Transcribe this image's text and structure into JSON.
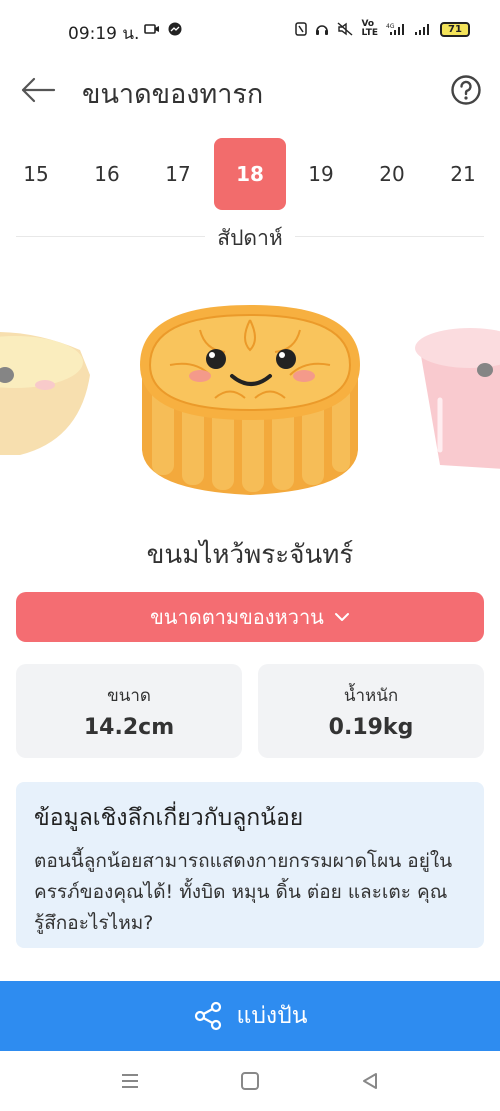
{
  "status": {
    "time": "09:19 น.",
    "battery": "71",
    "network": "4G"
  },
  "header": {
    "title": "ขนาดของทารก"
  },
  "weeks": {
    "items": [
      "15",
      "16",
      "17",
      "18",
      "19",
      "20",
      "21"
    ],
    "selected": "18",
    "label": "สัปดาห์"
  },
  "fruit": {
    "name": "ขนมไหว้พระจันทร์"
  },
  "dropdown": {
    "label": "ขนาดตามของหวาน"
  },
  "stats": {
    "size_label": "ขนาด",
    "size_value": "14.2cm",
    "weight_label": "น้ำหนัก",
    "weight_value": "0.19kg"
  },
  "insight": {
    "title": "ข้อมูลเชิงลึกเกี่ยวกับลูกน้อย",
    "body": "ตอนนี้ลูกน้อยสามารถแสดงกายกรรมผาดโผน อยู่ในครรภ์ของคุณได้! ทั้งบิด หมุน ดิ้น ต่อย และเตะ คุณรู้สึกอะไรไหม?"
  },
  "share": {
    "label": "แบ่งปัน"
  },
  "colors": {
    "accent_red": "#f46d72",
    "share_blue": "#2e8cf0",
    "insight_bg": "#e7f1fb",
    "card_bg": "#f2f3f5"
  }
}
